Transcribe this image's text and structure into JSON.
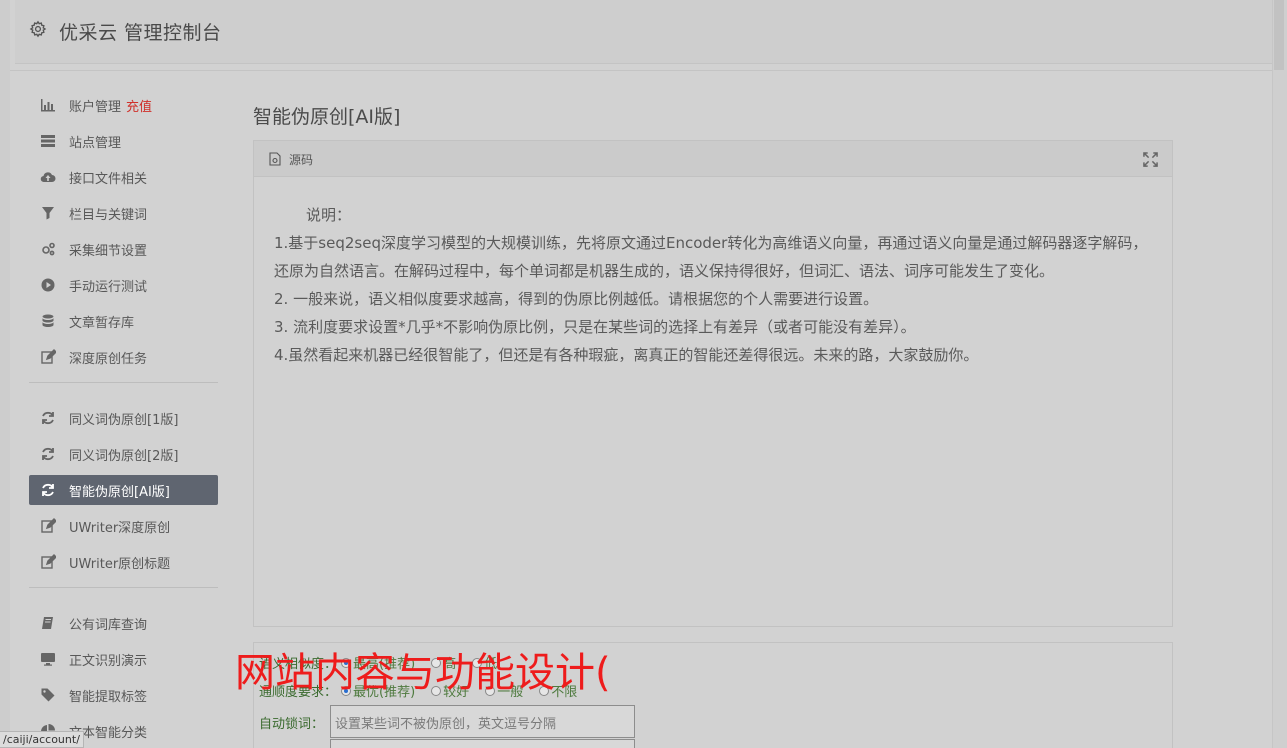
{
  "header": {
    "title": "优采云 管理控制台",
    "icon": "gear-icon"
  },
  "sidebar": {
    "group1": [
      {
        "label": "账户管理",
        "badge": "充值",
        "icon": "bar-chart-icon"
      },
      {
        "label": "站点管理",
        "icon": "server-icon"
      },
      {
        "label": "接口文件相关",
        "icon": "cloud-upload-icon"
      },
      {
        "label": "栏目与关键词",
        "icon": "filter-icon"
      },
      {
        "label": "采集细节设置",
        "icon": "gears-icon"
      },
      {
        "label": "手动运行测试",
        "icon": "play-circle-icon"
      },
      {
        "label": "文章暂存库",
        "icon": "database-icon"
      },
      {
        "label": "深度原创任务",
        "icon": "edit-icon"
      }
    ],
    "group2": [
      {
        "label": "同义词伪原创[1版]",
        "icon": "refresh-icon"
      },
      {
        "label": "同义词伪原创[2版]",
        "icon": "refresh-icon"
      },
      {
        "label": "智能伪原创[AI版]",
        "icon": "refresh-icon",
        "active": true
      },
      {
        "label": "UWriter深度原创",
        "icon": "edit-icon"
      },
      {
        "label": "UWriter原创标题",
        "icon": "edit-icon"
      }
    ],
    "group3": [
      {
        "label": "公有词库查询",
        "icon": "book-icon"
      },
      {
        "label": "正文识别演示",
        "icon": "desktop-icon"
      },
      {
        "label": "智能提取标签",
        "icon": "tag-icon"
      },
      {
        "label": "文本智能分类",
        "icon": "pie-chart-icon"
      }
    ]
  },
  "main": {
    "title": "智能伪原创[AI版]",
    "panel": {
      "header_label": "源码",
      "intro": "说明：",
      "lines": [
        "1.基于seq2seq深度学习模型的大规模训练，先将原文通过Encoder转化为高维语义向量，再通过语义向量是通过解码器逐字解码，还原为自然语言。在解码过程中，每个单词都是机器生成的，语义保持得很好，但词汇、语法、词序可能发生了变化。",
        "2. 一般来说，语义相似度要求越高，得到的伪原比例越低。请根据您的个人需要进行设置。",
        "3. 流利度要求设置*几乎*不影响伪原比例，只是在某些词的选择上有差异（或者可能没有差异）。",
        "4.虽然看起来机器已经很智能了，但还是有各种瑕疵，离真正的智能还差得很远。未来的路，大家鼓励你。"
      ]
    },
    "options": {
      "similarity": {
        "label": "语义相似度：",
        "choices": [
          "最高(推荐)",
          "高",
          "低"
        ],
        "selected": 0
      },
      "fluency": {
        "label": "通顺度要求：",
        "choices": [
          "最优(推荐)",
          "较好",
          "一般",
          "不限"
        ],
        "selected": 0
      },
      "autolock": {
        "label": "自动锁词：",
        "placeholder": "设置某些词不被伪原创，英文逗号分隔"
      }
    }
  },
  "overlay": {
    "watermark": "网站内容与功能设计("
  },
  "statusbar": {
    "url": "/caiji/account/"
  }
}
